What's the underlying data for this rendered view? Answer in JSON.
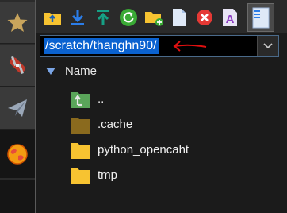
{
  "sidebar": {
    "tabs": [
      {
        "icon": "star-icon",
        "color": "#c8a45c"
      },
      {
        "icon": "swiss-knife-icon",
        "color": "#c0392b"
      },
      {
        "icon": "paper-plane-icon",
        "color": "#9aa7b8"
      },
      {
        "icon": "globe-icon",
        "color": "#f39c12"
      }
    ]
  },
  "toolbar": {
    "buttons": [
      {
        "icon": "folder-up-icon"
      },
      {
        "icon": "download-icon"
      },
      {
        "icon": "upload-icon"
      },
      {
        "icon": "refresh-icon"
      },
      {
        "icon": "new-folder-icon"
      },
      {
        "icon": "new-file-icon"
      },
      {
        "icon": "delete-icon"
      },
      {
        "icon": "rename-icon",
        "glyph": "A"
      },
      {
        "icon": "view-panel-icon"
      }
    ]
  },
  "path_bar": {
    "value": "/scratch/thanghn90/"
  },
  "file_list": {
    "column_header": "Name",
    "items": [
      {
        "name": "..",
        "icon": "parent-folder-icon"
      },
      {
        "name": ".cache",
        "icon": "hidden-folder-icon"
      },
      {
        "name": "python_opencaht",
        "icon": "folder-icon"
      },
      {
        "name": "tmp",
        "icon": "folder-icon"
      }
    ]
  },
  "colors": {
    "accent": "#0a62d0",
    "folder": "#f7c331",
    "hidden_folder": "#8a6a1e",
    "annotation": "#e01010"
  }
}
